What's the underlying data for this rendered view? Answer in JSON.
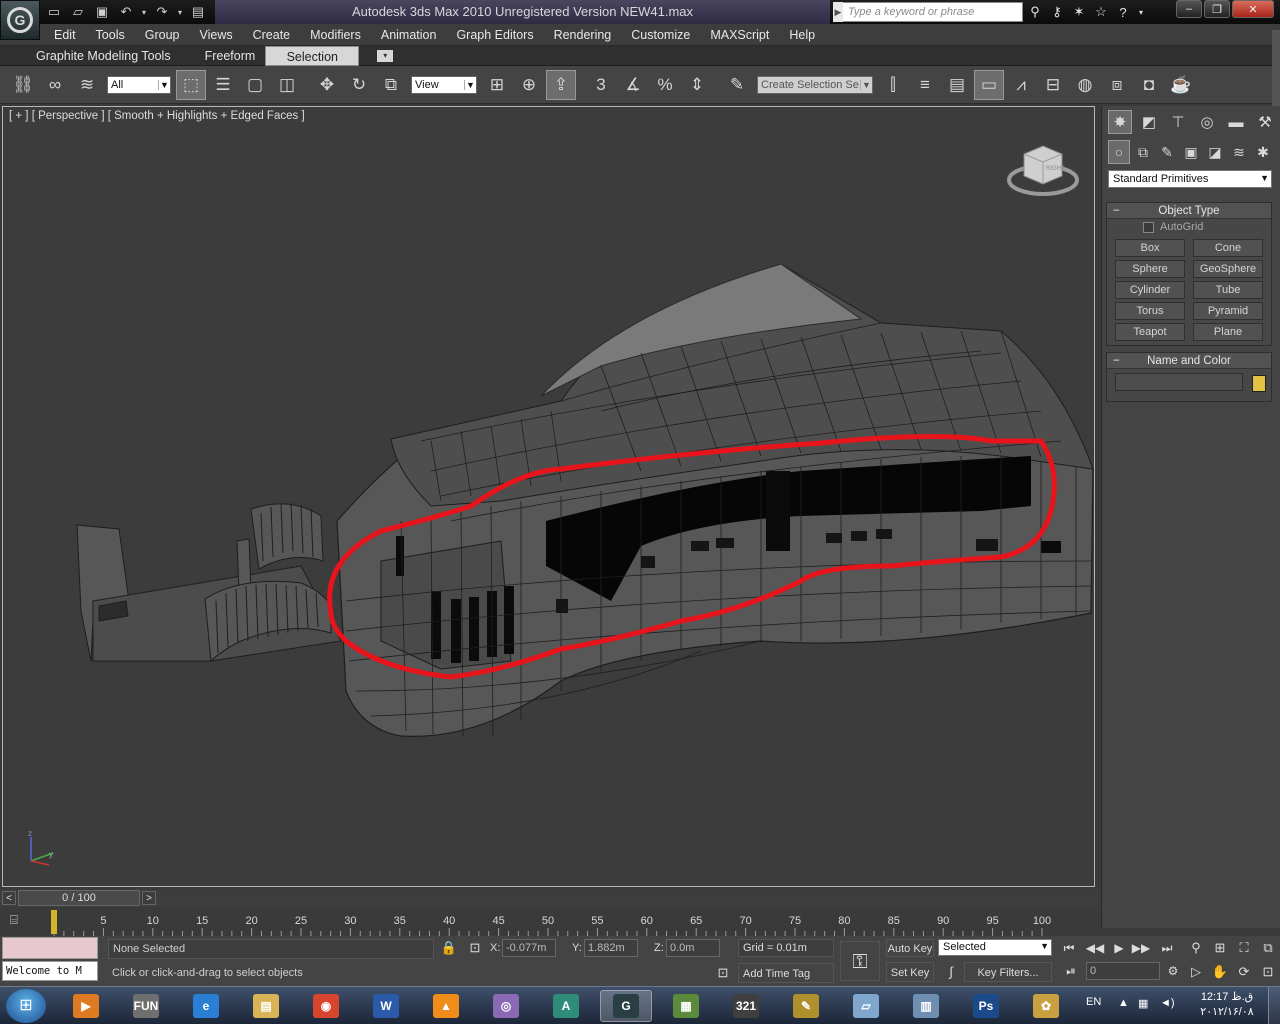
{
  "window": {
    "title": "Autodesk 3ds Max  2010    Unregistered Version        NEW41.max",
    "search_placeholder": "Type a keyword or phrase",
    "controls": [
      "minimize",
      "maximize",
      "close"
    ]
  },
  "menu": [
    "Edit",
    "Tools",
    "Group",
    "Views",
    "Create",
    "Modifiers",
    "Animation",
    "Graph Editors",
    "Rendering",
    "Customize",
    "MAXScript",
    "Help"
  ],
  "ribbon": {
    "tabs": [
      "Graphite Modeling Tools",
      "Freeform",
      "Selection"
    ],
    "active_tab": "Selection"
  },
  "toolbar": {
    "selection_filter": "All",
    "reference_coord": "View",
    "named_selection_placeholder": "Create Selection Se",
    "snap_label": "3"
  },
  "viewport": {
    "label": "[ + ] [ Perspective ] [ Smooth + Highlights + Edged Faces ]",
    "viewcube_label": "RIGHT",
    "axis_labels": {
      "z": "z",
      "x": "x",
      "y": "y"
    },
    "annotation_color": "#e8141c"
  },
  "command_panel": {
    "category": "Standard Primitives",
    "object_type": {
      "title": "Object Type",
      "autogrid": "AutoGrid",
      "buttons": [
        "Box",
        "Cone",
        "Sphere",
        "GeoSphere",
        "Cylinder",
        "Tube",
        "Torus",
        "Pyramid",
        "Teapot",
        "Plane"
      ]
    },
    "name_and_color": {
      "title": "Name and Color",
      "name_value": "",
      "color": "#e2c244"
    }
  },
  "timeline": {
    "frame_display": "0 / 100",
    "ticks": [
      "5",
      "10",
      "15",
      "20",
      "25",
      "30",
      "35",
      "40",
      "45",
      "50",
      "55",
      "60",
      "65",
      "70",
      "75",
      "80",
      "85",
      "90",
      "95",
      "100"
    ]
  },
  "status": {
    "script_listener": "Welcome to M",
    "selection": "None Selected",
    "prompt": "Click or click-and-drag to select objects",
    "x_label": "X:",
    "x_value": "-0.077m",
    "y_label": "Y:",
    "y_value": "1.882m",
    "z_label": "Z:",
    "z_value": "0.0m",
    "grid": "Grid = 0.01m",
    "add_time_tag": "Add Time Tag",
    "auto_key": "Auto Key",
    "set_key": "Set Key",
    "key_mode": "Selected",
    "key_filters": "Key Filters...",
    "frame_value": "0"
  },
  "taskbar": {
    "apps": [
      {
        "name": "media-player",
        "label": "▶",
        "color": "#e07a22"
      },
      {
        "name": "fun-drive",
        "label": "FUN",
        "color": "#6f6f6f"
      },
      {
        "name": "internet-explorer",
        "label": "e",
        "color": "#2a7fd4"
      },
      {
        "name": "explorer",
        "label": "▤",
        "color": "#d9b456"
      },
      {
        "name": "chrome",
        "label": "◉",
        "color": "#d8452f"
      },
      {
        "name": "word",
        "label": "W",
        "color": "#2b5aa8"
      },
      {
        "name": "vlc",
        "label": "▲",
        "color": "#f08c1a"
      },
      {
        "name": "dvd",
        "label": "◎",
        "color": "#8a6ab4"
      },
      {
        "name": "autocad",
        "label": "A",
        "color": "#2e8c78"
      },
      {
        "name": "3dsmax",
        "label": "G",
        "color": "#2a3f44"
      },
      {
        "name": "monitor",
        "label": "▦",
        "color": "#5a8a3a"
      },
      {
        "name": "media-321",
        "label": "321",
        "color": "#3f3f3f"
      },
      {
        "name": "tools",
        "label": "✎",
        "color": "#b0902c"
      },
      {
        "name": "notes",
        "label": "▱",
        "color": "#7fa6cc"
      },
      {
        "name": "calculator",
        "label": "▥",
        "color": "#6f8fb0"
      },
      {
        "name": "photoshop",
        "label": "Ps",
        "color": "#1b4a8a"
      },
      {
        "name": "paint",
        "label": "✿",
        "color": "#c8a040"
      }
    ],
    "active_app": "3dsmax",
    "language": "EN",
    "time": "12:17 ق.ظ",
    "date": "۲۰۱۲/۱۶/۰۸"
  }
}
